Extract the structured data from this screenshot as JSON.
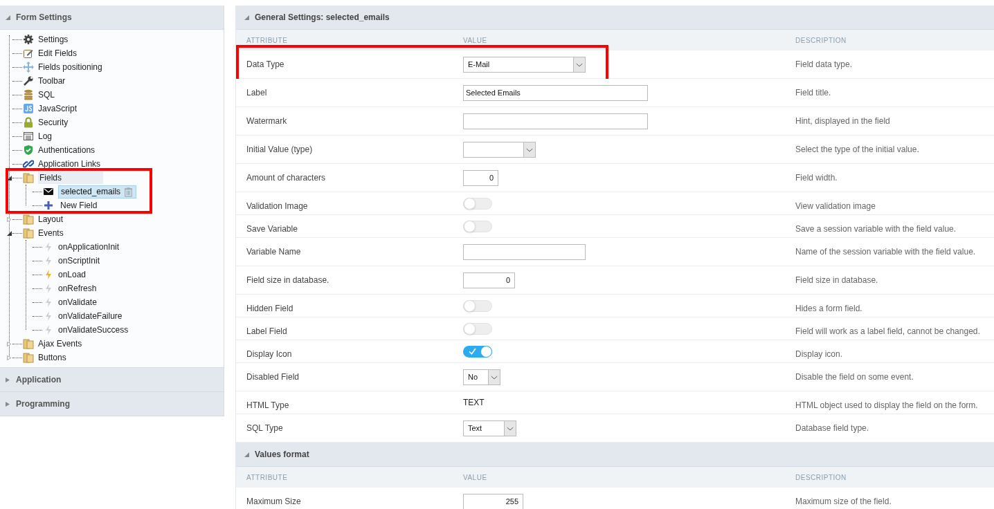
{
  "sidebar": {
    "sections": [
      {
        "title": "Form Settings",
        "expanded": true,
        "tree": [
          {
            "label": "Settings",
            "kind": "gear"
          },
          {
            "label": "Edit Fields",
            "kind": "edit"
          },
          {
            "label": "Fields positioning",
            "kind": "move"
          },
          {
            "label": "Toolbar",
            "kind": "wrench"
          },
          {
            "label": "SQL",
            "kind": "database"
          },
          {
            "label": "JavaScript",
            "kind": "js"
          },
          {
            "label": "Security",
            "kind": "lock"
          },
          {
            "label": "Log",
            "kind": "log"
          },
          {
            "label": "Authentications",
            "kind": "shield"
          },
          {
            "label": "Application Links",
            "kind": "link"
          },
          {
            "label": "Fields",
            "kind": "folder",
            "expanded": true,
            "highlighted": true,
            "children": [
              {
                "label": "selected_emails",
                "kind": "mail",
                "selected": true
              },
              {
                "label": "New Field",
                "kind": "plus",
                "selected": false
              }
            ]
          },
          {
            "label": "Layout",
            "kind": "folder",
            "expanded": false
          },
          {
            "label": "Events",
            "kind": "folder",
            "expanded": true,
            "children": [
              {
                "label": "onApplicationInit",
                "kind": "event",
                "active": false
              },
              {
                "label": "onScriptInit",
                "kind": "event",
                "active": false
              },
              {
                "label": "onLoad",
                "kind": "event",
                "active": true
              },
              {
                "label": "onRefresh",
                "kind": "event",
                "active": false
              },
              {
                "label": "onValidate",
                "kind": "event",
                "active": false
              },
              {
                "label": "onValidateFailure",
                "kind": "event",
                "active": false
              },
              {
                "label": "onValidateSuccess",
                "kind": "event",
                "active": false
              }
            ]
          },
          {
            "label": "Ajax Events",
            "kind": "folder",
            "expanded": false
          },
          {
            "label": "Buttons",
            "kind": "folder",
            "expanded": false
          }
        ]
      },
      {
        "title": "Application",
        "expanded": false
      },
      {
        "title": "Programming",
        "expanded": false
      }
    ]
  },
  "panels": [
    {
      "title": "General Settings: selected_emails",
      "columns": [
        "ATTRIBUTE",
        "VALUE",
        "DESCRIPTION"
      ],
      "rows": [
        {
          "attribute": "Data Type",
          "kind": "select",
          "value": "E-Mail",
          "description": "Field data type.",
          "highlighted": true
        },
        {
          "attribute": "Label",
          "kind": "text",
          "value": "Selected Emails",
          "description": "Field title."
        },
        {
          "attribute": "Watermark",
          "kind": "text",
          "description": "Hint, displayed in the field"
        },
        {
          "attribute": "Initial Value (type)",
          "kind": "select",
          "description": "Select the type of the initial value."
        },
        {
          "attribute": "Amount of characters",
          "kind": "number",
          "value": "0",
          "description": "Field width."
        },
        {
          "attribute": "Validation Image",
          "kind": "toggle",
          "on": false,
          "description": "View validation image"
        },
        {
          "attribute": "Save Variable",
          "kind": "toggle",
          "on": false,
          "description": "Save a session variable with the field value."
        },
        {
          "attribute": "Variable Name",
          "kind": "text",
          "description": "Name of the session variable with the field value."
        },
        {
          "attribute": "Field size in database.",
          "kind": "number",
          "value": "0",
          "description": "Field size in database."
        },
        {
          "attribute": "Hidden Field",
          "kind": "toggle",
          "on": false,
          "description": "Hides a form field."
        },
        {
          "attribute": "Label Field",
          "kind": "toggle",
          "on": false,
          "description": "Field will work as a label field, cannot be changed."
        },
        {
          "attribute": "Display Icon",
          "kind": "toggle",
          "on": true,
          "description": "Display icon."
        },
        {
          "attribute": "Disabled Field",
          "kind": "select",
          "value": "No",
          "description": "Disable the field on some event."
        },
        {
          "attribute": "HTML Type",
          "kind": "static",
          "value": "TEXT",
          "description": "HTML object used to display the field on the form."
        },
        {
          "attribute": "SQL Type",
          "kind": "select",
          "value": "Text",
          "description": "Database field type."
        }
      ]
    },
    {
      "title": "Values format",
      "columns": [
        "ATTRIBUTE",
        "VALUE",
        "DESCRIPTION"
      ],
      "rows": [
        {
          "attribute": "Maximum Size",
          "kind": "number",
          "value": "255",
          "description": "Maximum size of the field."
        }
      ]
    }
  ]
}
